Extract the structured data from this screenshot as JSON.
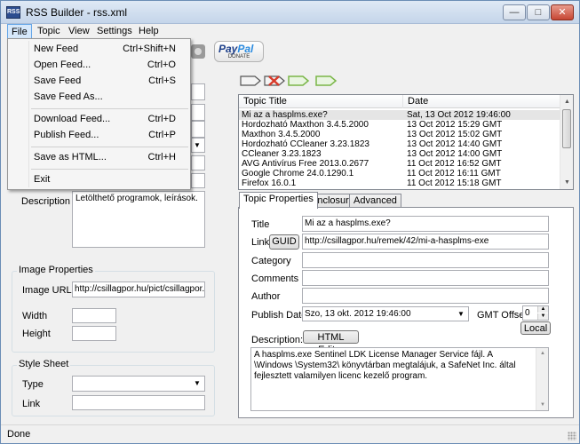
{
  "window": {
    "title": "RSS Builder - rss.xml",
    "app_icon_text": "RSS"
  },
  "menubar": {
    "items": [
      "File",
      "Topic",
      "View",
      "Settings",
      "Help"
    ]
  },
  "file_menu": {
    "items": [
      {
        "label": "New Feed",
        "shortcut": "Ctrl+Shift+N"
      },
      {
        "label": "Open Feed...",
        "shortcut": "Ctrl+O"
      },
      {
        "label": "Save Feed",
        "shortcut": "Ctrl+S"
      },
      {
        "label": "Save Feed As...",
        "shortcut": ""
      },
      {
        "label": "Download Feed...",
        "shortcut": "Ctrl+D"
      },
      {
        "label": "Publish Feed...",
        "shortcut": "Ctrl+P"
      },
      {
        "label": "Save as HTML...",
        "shortcut": "Ctrl+H"
      },
      {
        "label": "Exit",
        "shortcut": ""
      }
    ]
  },
  "toolbar": {
    "paypal_brand": "Pay",
    "paypal_brand2": "Pal",
    "paypal_sub": "DONATE"
  },
  "channel": {
    "description_label": "Description",
    "description_value": "Letölthető programok, leírások."
  },
  "image_properties": {
    "group_title": "Image Properties",
    "url_label": "Image URL",
    "url_value": "http://csillagpor.hu/pict/csillagpor.jpg",
    "width_label": "Width",
    "width_value": "",
    "height_label": "Height",
    "height_value": ""
  },
  "style_sheet": {
    "group_title": "Style Sheet",
    "type_label": "Type",
    "type_value": "",
    "link_label": "Link",
    "link_value": ""
  },
  "topic_list": {
    "columns": [
      "Topic Title",
      "Date"
    ],
    "rows": [
      {
        "title": "Mi az a hasplms.exe?",
        "date": "Sat, 13 Oct 2012 19:46:00"
      },
      {
        "title": "Hordozható Maxthon 3.4.5.2000",
        "date": "13 Oct 2012 15:29 GMT"
      },
      {
        "title": "Maxthon 3.4.5.2000",
        "date": "13 Oct 2012 15:02 GMT"
      },
      {
        "title": "Hordozható CCleaner 3.23.1823",
        "date": "13 Oct 2012 14:40 GMT"
      },
      {
        "title": "CCleaner 3.23.1823",
        "date": "13 Oct 2012 14:00 GMT"
      },
      {
        "title": "AVG Antivírus Free 2013.0.2677",
        "date": "11 Oct 2012 16:52 GMT"
      },
      {
        "title": "Google Chrome 24.0.1290.1",
        "date": "11 Oct 2012 16:11 GMT"
      },
      {
        "title": "Firefox 16.0.1",
        "date": "11 Oct 2012 15:18 GMT"
      }
    ]
  },
  "tabs": [
    "Topic Properties",
    "Enclosure",
    "Advanced"
  ],
  "topic_properties": {
    "title_label": "Title",
    "title_value": "Mi az a hasplms.exe?",
    "link_label": "Link",
    "guid_button": "GUID",
    "link_value": "http://csillagpor.hu/remek/42/mi-a-hasplms-exe",
    "category_label": "Category",
    "category_value": "",
    "comments_label": "Comments",
    "comments_value": "",
    "author_label": "Author",
    "author_value": "",
    "publish_date_label": "Publish Date",
    "publish_date_value": "Szo, 13  okt.  2012 19:46:00",
    "gmt_offset_label": "GMT Offset",
    "gmt_offset_value": "0",
    "local_button": "Local",
    "description_label": "Description:",
    "html_editor_button": "HTML Editor",
    "description_value": "A hasplms.exe Sentinel LDK License Manager Service fájl. A \\Windows \\System32\\ könyvtárban megtalájuk, a SafeNet Inc. által fejlesztett valamilyen licenc kezelő program."
  },
  "statusbar": {
    "text": "Done"
  },
  "colors": {
    "menu_highlight": "#d6e8fb",
    "selection": "#e5e5e5",
    "frame": "#6b8db5"
  }
}
